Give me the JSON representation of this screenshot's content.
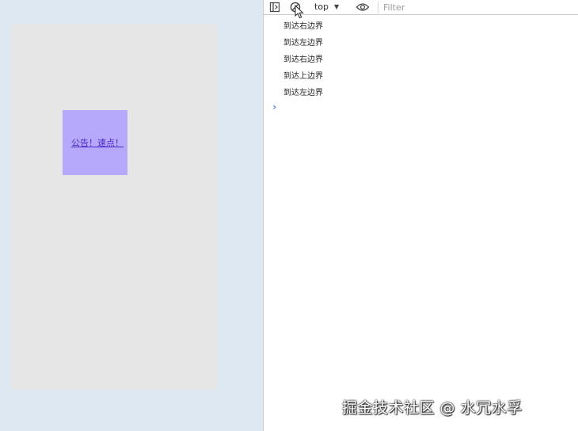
{
  "preview": {
    "link_text": "公告！速点！"
  },
  "devtools": {
    "toolbar": {
      "sidebar_icon": "sidebar-toggle-icon",
      "clear_icon": "clear-console-icon",
      "context": "top",
      "eye_icon": "eye-icon",
      "filter_placeholder": "Filter"
    },
    "console": {
      "messages": [
        "到达右边界",
        "到达左边界",
        "到达右边界",
        "到达上边界",
        "到达左边界"
      ],
      "prompt_symbol": "›"
    }
  },
  "watermark": "掘金技术社区 @ 水冗水孚",
  "colors": {
    "box": "#b6a8fa",
    "link": "#4b2ac2",
    "prompt": "#3474d9"
  }
}
